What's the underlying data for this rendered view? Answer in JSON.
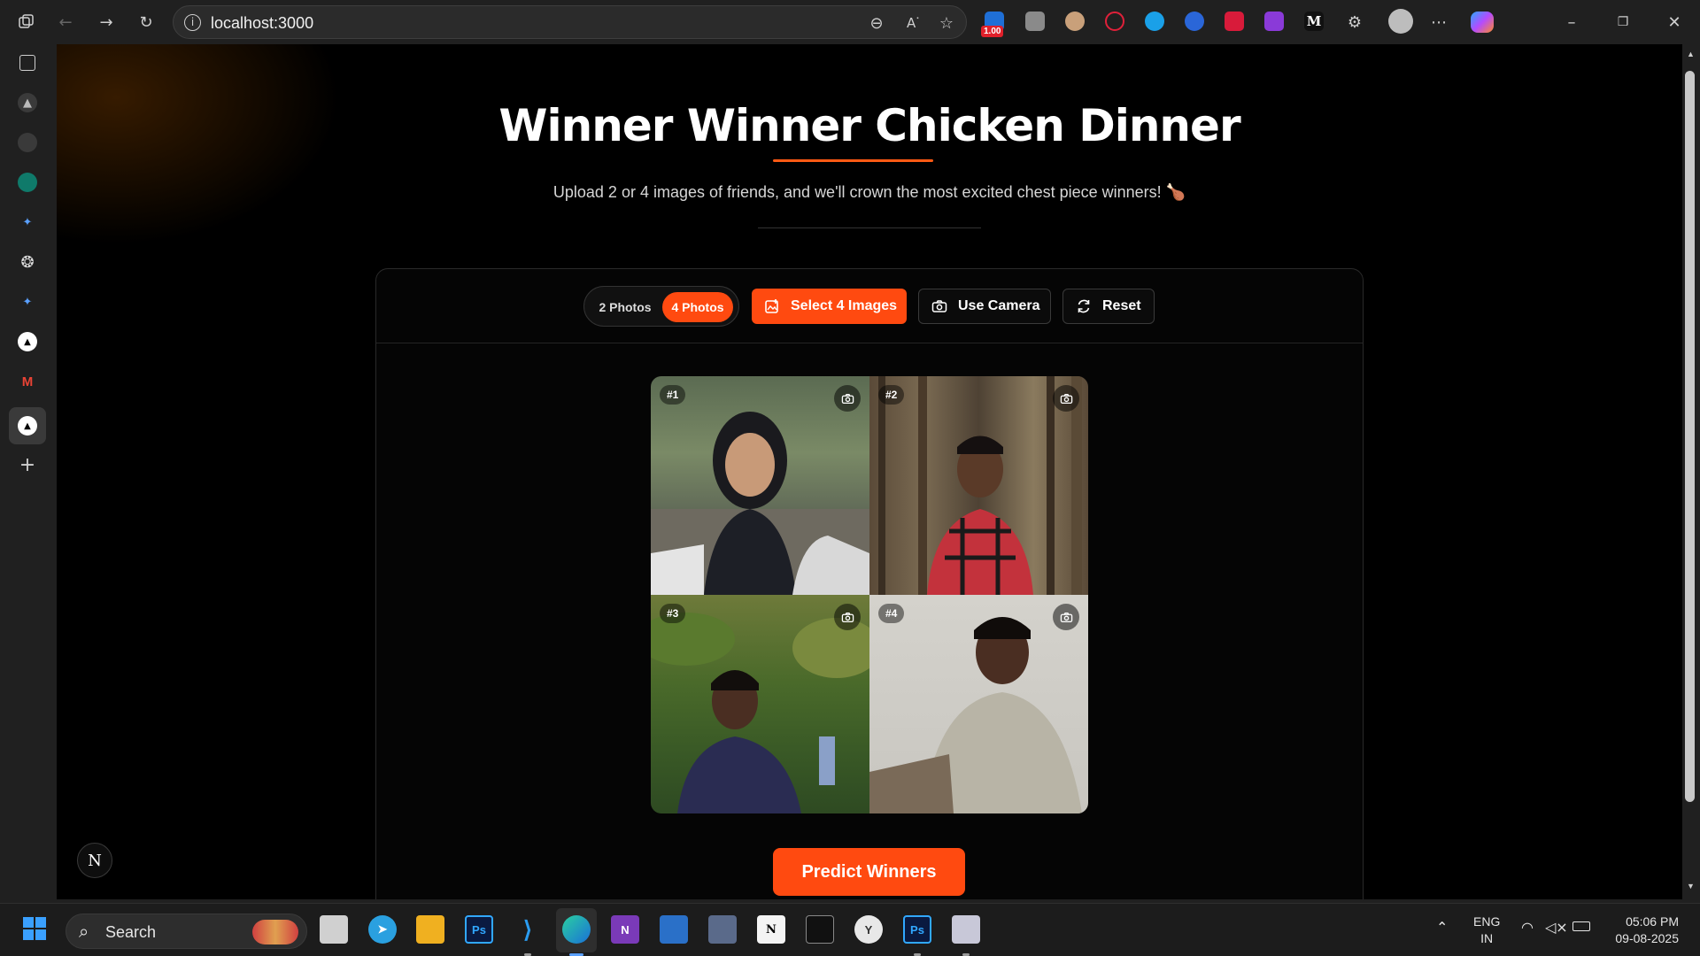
{
  "browser": {
    "url": "localhost:3000",
    "extension_badge": "1.00"
  },
  "page": {
    "title": "Winner Winner Chicken Dinner",
    "subtitle": "Upload 2 or 4 images of friends, and we'll crown the most excited chest piece winners! 🍗",
    "toggle": {
      "option_2": "2 Photos",
      "option_4": "4 Photos",
      "selected": "4 Photos"
    },
    "buttons": {
      "select": "Select 4 Images",
      "camera": "Use Camera",
      "reset": "Reset"
    },
    "tiles": [
      {
        "badge": "#1"
      },
      {
        "badge": "#2"
      },
      {
        "badge": "#3"
      },
      {
        "badge": "#4"
      }
    ],
    "predict_label": "Predict Winners",
    "next_badge": "N"
  },
  "taskbar": {
    "search_label": "Search",
    "lang_top": "ENG",
    "lang_bottom": "IN",
    "time": "05:06 PM",
    "date": "09-08-2025"
  },
  "colors": {
    "accent": "#ff4a10",
    "background": "#000000",
    "chrome": "#202020"
  }
}
